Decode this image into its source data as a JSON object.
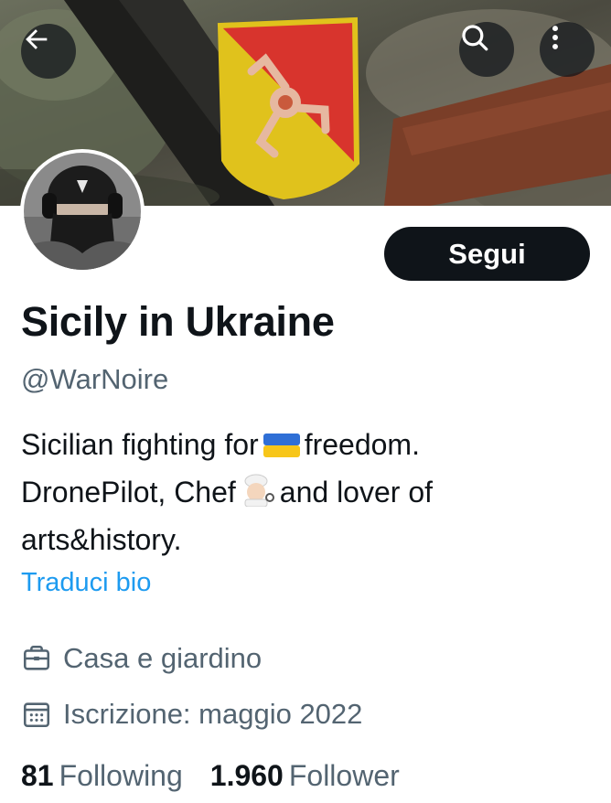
{
  "header": {
    "back_icon": "arrow-left-icon",
    "search_icon": "search-icon",
    "more_icon": "more-vertical-icon"
  },
  "profile": {
    "follow_label": "Segui",
    "name": "Sicily in Ukraine",
    "handle": "@WarNoire",
    "bio": {
      "line1_a": "Sicilian fighting for",
      "line1_emoji": "ukraine-flag",
      "line1_b": "freedom.",
      "line2_a": "DronePilot,  Chef",
      "line2_emoji": "chef-emoji",
      "line2_b": "and lover of",
      "line3": "arts&history."
    },
    "translate_label": "Traduci bio",
    "category": "Casa e giardino",
    "joined": "Iscrizione: maggio 2022",
    "following_count": "81",
    "following_label": "Following",
    "followers_count": "1.960",
    "followers_label": "Follower"
  },
  "colors": {
    "text": "#0f1419",
    "secondary": "#536471",
    "link": "#1d9bf0",
    "button": "#0f1419"
  }
}
